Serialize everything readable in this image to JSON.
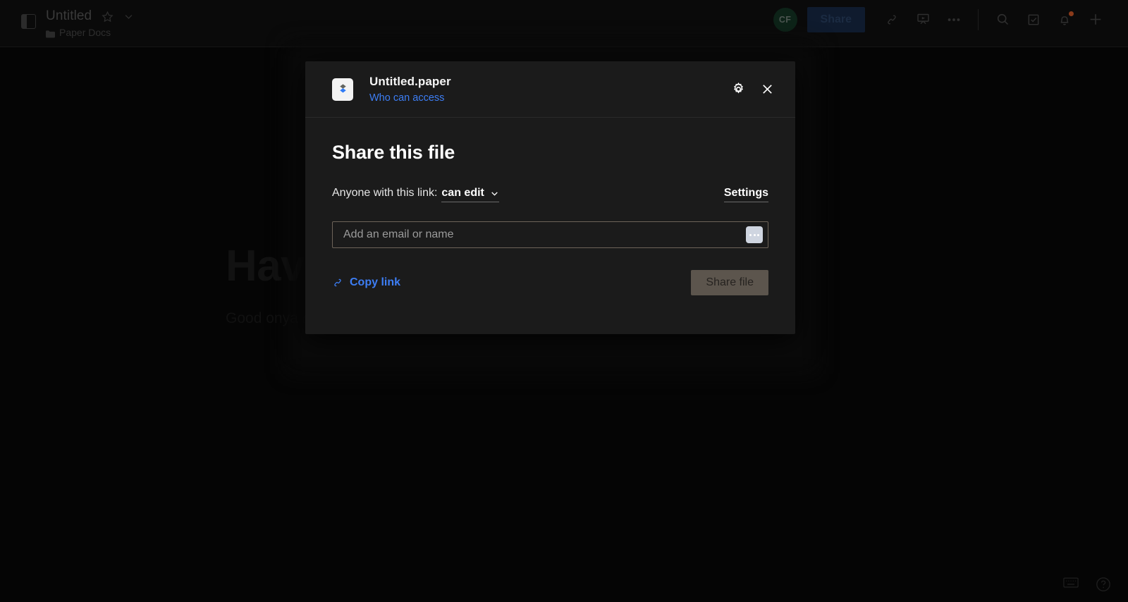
{
  "topbar": {
    "sidebar_toggle_name": "sidebar-toggle-icon",
    "doc_title": "Untitled",
    "star_icon": "star-icon",
    "chevron_icon": "chevron-down-icon",
    "breadcrumb_folder_icon": "folder-icon",
    "breadcrumb_label": "Paper Docs",
    "avatar_initials": "CF",
    "avatar_color": "#0d2318",
    "share_label": "Share",
    "share_button_color": "#0f1b2e",
    "icons": [
      {
        "name": "link-icon",
        "title": "Copy link"
      },
      {
        "name": "presentation-icon",
        "title": "Present"
      },
      {
        "name": "ellipsis-icon",
        "title": "More"
      }
    ],
    "right_icons": [
      {
        "name": "search-icon",
        "title": "Search"
      },
      {
        "name": "todo-checkbox-icon",
        "title": "To-dos"
      },
      {
        "name": "bell-icon",
        "title": "Notifications",
        "badge": true
      },
      {
        "name": "plus-icon",
        "title": "New"
      }
    ],
    "notification_badge_color": "#8a3a1a"
  },
  "document": {
    "heading": "Have",
    "body": "Good onya m"
  },
  "modal": {
    "file_icon": "dropbox-paper-file-icon",
    "file_name": "Untitled.paper",
    "who_can_access_label": "Who can access",
    "settings_gear_icon": "gear-icon",
    "close_icon": "close-icon",
    "heading": "Share this file",
    "permission_prefix": "Anyone with this link:",
    "permission_value": "can edit",
    "permission_chevron_icon": "chevron-down-icon",
    "settings_label": "Settings",
    "email_placeholder": "Add an email or name",
    "email_value": "",
    "contacts_button_icon": "ellipsis-contacts-icon",
    "copy_link_icon": "link-icon",
    "copy_link_label": "Copy link",
    "copy_link_color": "#3d7ef5",
    "share_file_label": "Share file",
    "share_file_button_color": "#5c554d"
  },
  "bottom": {
    "keyboard_icon": "keyboard-shortcuts-icon",
    "help_icon": "help-question-icon"
  }
}
